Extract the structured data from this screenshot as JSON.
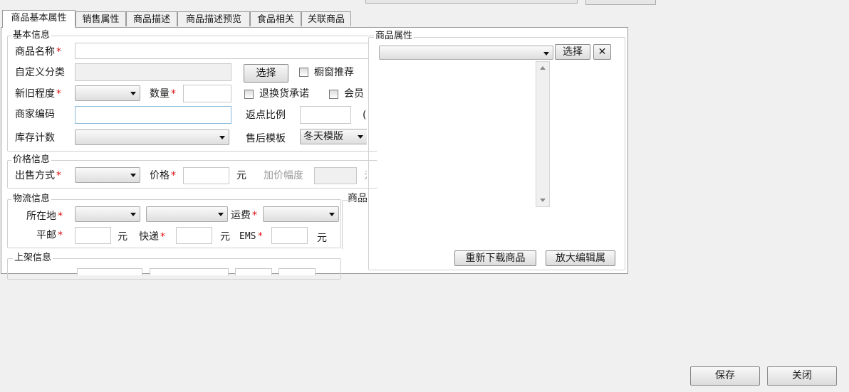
{
  "tabs": [
    "商品基本属性",
    "销售属性",
    "商品描述",
    "商品描述预览",
    "食品相关",
    "关联商品"
  ],
  "basic_info": {
    "title": "基本信息",
    "product_name_label": "商品名称",
    "custom_category_label": "自定义分类",
    "select_button": "选择",
    "window_recommend_label": "橱窗推荐",
    "condition_label": "新旧程度",
    "quantity_label": "数量",
    "return_promise_label": "退换货承诺",
    "member_label": "会员",
    "merchant_code_label": "商家编码",
    "rebate_label": "返点比例",
    "rebate_suffix": "(",
    "stock_count_label": "库存计数",
    "after_sale_label": "售后模板",
    "after_sale_value": "冬天模版",
    "required_mark": "*"
  },
  "price_info": {
    "title": "价格信息",
    "sale_method_label": "出售方式",
    "price_label": "价格",
    "price_unit": "元",
    "markup_label": "加价幅度",
    "markup_suffix": "元"
  },
  "logistics_info": {
    "title": "物流信息",
    "location_label": "所在地",
    "shipping_label": "运费",
    "surface_mail_label": "平邮",
    "express_label": "快递",
    "ems_label": "EMS",
    "unit": "元",
    "right_cut_label": "商品"
  },
  "listing_info": {
    "title": "上架信息"
  },
  "product_attributes": {
    "title": "商品属性",
    "select_button": "选择",
    "clear_icon": "close-icon",
    "reload_button": "重新下载商品",
    "enlarge_button": "放大编辑属"
  },
  "footer": {
    "save_button": "保存",
    "close_button": "关闭"
  },
  "colors": {
    "required": "#dd1111",
    "panel_bg": "#ffffff",
    "window_bg": "#f0f0f0"
  }
}
